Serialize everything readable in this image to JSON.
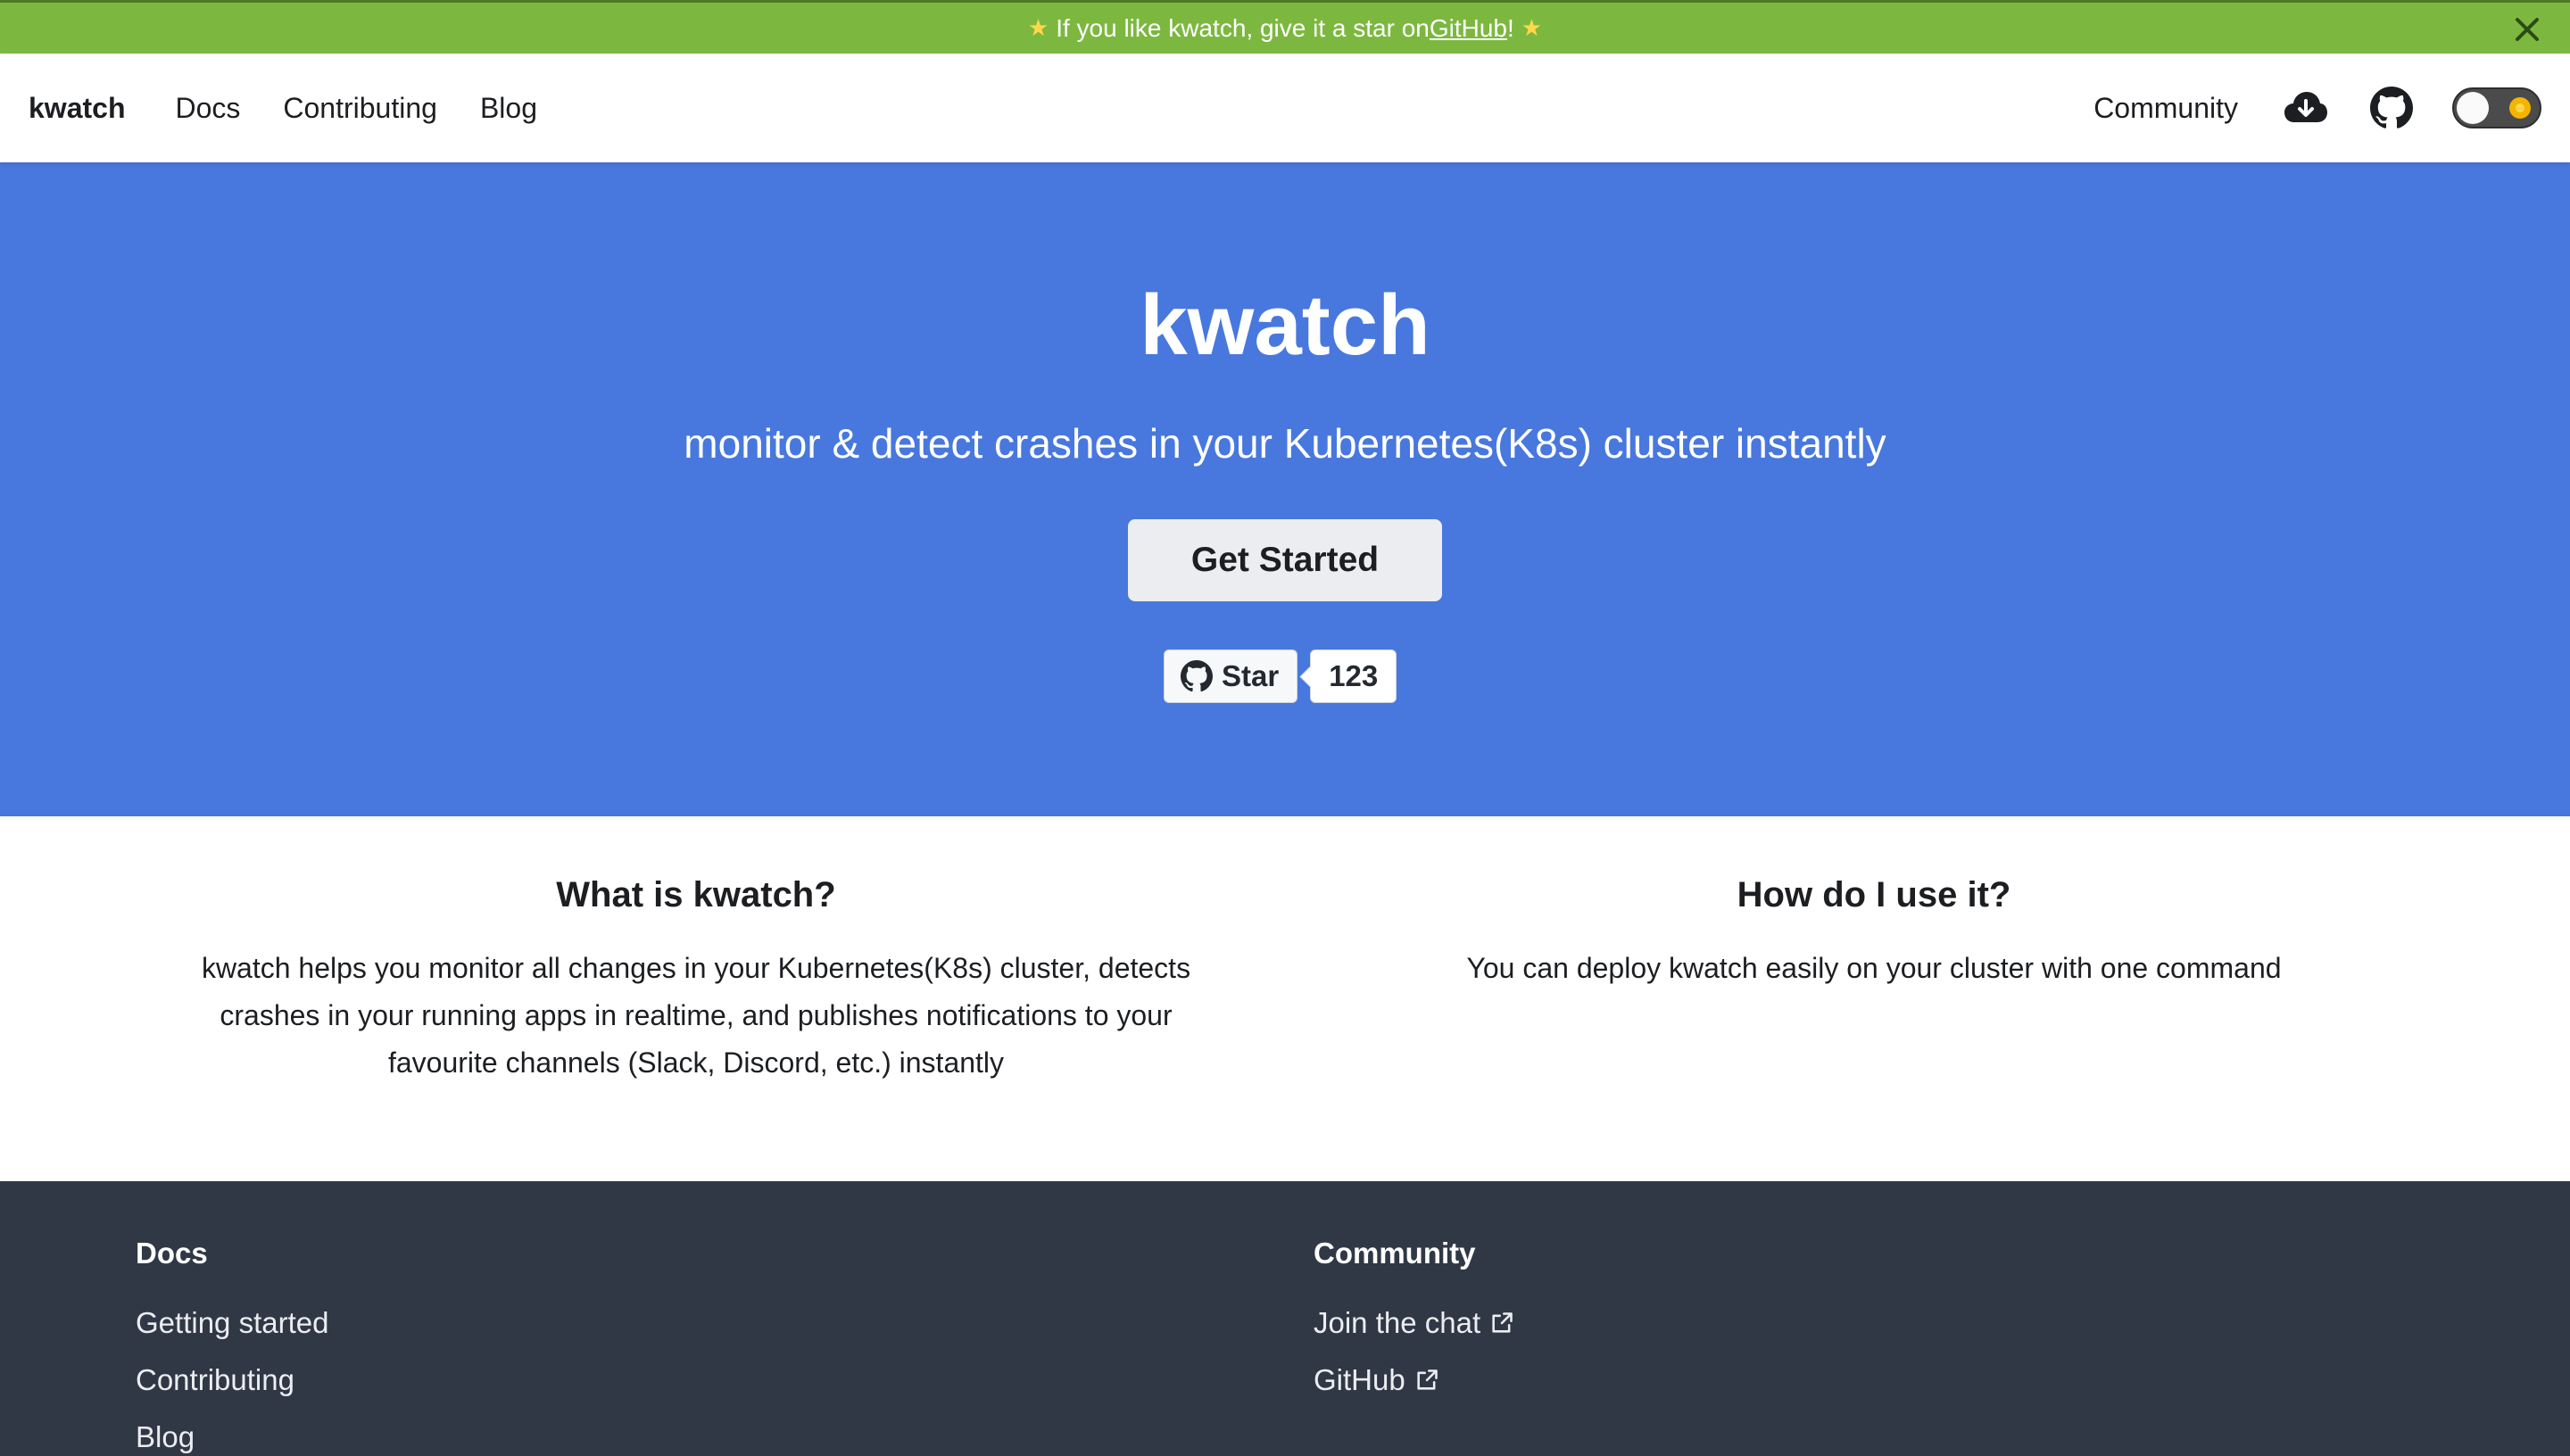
{
  "announcement": {
    "prefix": "If you like kwatch, give it a star on ",
    "link_text": "GitHub",
    "suffix": "!",
    "star_glyph": "★",
    "close_icon": "close-icon",
    "background": "#7cb83f"
  },
  "navbar": {
    "brand": "kwatch",
    "links": [
      "Docs",
      "Contributing",
      "Blog"
    ],
    "right_link": "Community",
    "icons": [
      "cloud-download-icon",
      "github-icon"
    ],
    "theme_toggle": "dark-mode-toggle"
  },
  "hero": {
    "title": "kwatch",
    "tagline": "monitor & detect crashes in your Kubernetes(K8s) cluster instantly",
    "cta_label": "Get Started",
    "star_label": "Star",
    "star_count": "123",
    "background": "#4878de"
  },
  "features": [
    {
      "title": "What is kwatch?",
      "text_lines": [
        "kwatch helps you monitor all changes in your Kubernetes(K8s) cluster, detects",
        "crashes in your running apps in realtime, and publishes notifications to your",
        "favourite channels (Slack, Discord, etc.) instantly"
      ]
    },
    {
      "title": "How do I use it?",
      "text_lines": [
        "You can deploy kwatch easily on your cluster with one command"
      ]
    }
  ],
  "footer": {
    "columns": [
      {
        "title": "Docs",
        "links": [
          "Getting started",
          "Contributing",
          "Blog"
        ]
      },
      {
        "title": "Community",
        "links": [
          "Join the chat",
          "GitHub"
        ]
      }
    ],
    "background": "#303846"
  }
}
